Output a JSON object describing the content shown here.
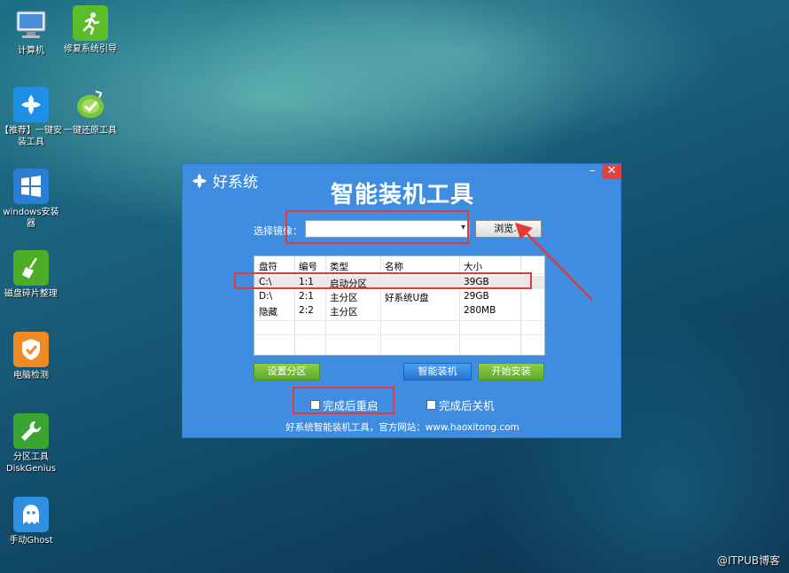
{
  "desktop": {
    "icons": [
      {
        "label": "计算机"
      },
      {
        "label": "修复系统引导"
      },
      {
        "label": "【推荐】一键安装工具"
      },
      {
        "label": "一键还原工具"
      },
      {
        "label": "windows安装器"
      },
      {
        "label": "磁盘碎片整理"
      },
      {
        "label": "电脑检测"
      },
      {
        "label": "分区工具DiskGenius"
      },
      {
        "label": "手动Ghost"
      }
    ]
  },
  "window": {
    "brand": "好系统",
    "title": "智能装机工具",
    "minimize": "–",
    "close": "✕",
    "image_label": "选择镜像：",
    "image_value": "",
    "browse_label": "浏览...",
    "table": {
      "headers": [
        "盘符",
        "编号",
        "类型",
        "名称",
        "大小"
      ],
      "rows": [
        [
          "C:\\",
          "1:1",
          "启动分区",
          "",
          "39GB"
        ],
        [
          "D:\\",
          "2:1",
          "主分区",
          "好系统U盘",
          "29GB"
        ],
        [
          "隐藏",
          "2:2",
          "主分区",
          "",
          "280MB"
        ]
      ]
    },
    "set_partition": "设置分区",
    "smart_install": "智能装机",
    "start_install": "开始安装",
    "restart_after": "完成后重启",
    "shutdown_after": "完成后关机",
    "footer": "好系统智能装机工具，官方网站：www.haoxitong.com"
  },
  "watermark": "@ITPUB博客"
}
